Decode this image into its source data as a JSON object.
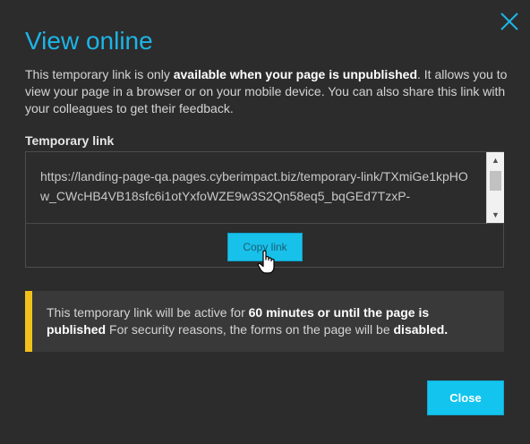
{
  "modal": {
    "title": "View online",
    "intro": {
      "part1": "This temporary link is only ",
      "bold1": "available when your page is unpublished",
      "part2": ". It allows you to view your page in a browser or on your mobile device. You can also share this link with your colleagues to get their feedback."
    },
    "field_label": "Temporary link",
    "link_value": "https://landing-page-qa.pages.cyberimpact.biz/temporary-link/TXmiGe1kpHOw_CWcHB4VB18sfc6i1otYxfoWZE9w3S2Qn58eq5_bqGEd7TzxP-",
    "copy_label": "Copy link",
    "notice": {
      "part1": "This temporary link will be active for ",
      "bold1": "60 minutes or until the page is published",
      "part2": " For security reasons, the forms on the page will be ",
      "bold2": "disabled."
    },
    "close_label": "Close"
  },
  "colors": {
    "accent": "#1db4e6",
    "button": "#13c4ee",
    "warning_stripe": "#f2c01b",
    "background": "#2c2c2c"
  },
  "icons": {
    "close": "close-icon",
    "cursor": "hand-pointer-icon",
    "scroll_up": "arrow-up-icon",
    "scroll_down": "arrow-down-icon"
  }
}
